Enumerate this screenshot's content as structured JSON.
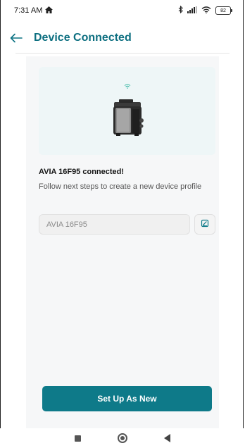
{
  "status_bar": {
    "time": "7:31 AM",
    "home_icon": "home-icon",
    "bluetooth_icon": "bluetooth-icon",
    "signal_icon": "signal-icon",
    "wifi_icon": "wifi-icon",
    "battery_level": "82"
  },
  "header": {
    "back_icon": "back-arrow-icon",
    "title": "Device Connected"
  },
  "device": {
    "wifi_indicator": "wifi-icon",
    "image": "device-icon",
    "connected_message": "AVIA 16F95 connected!",
    "instructions": "Follow next steps to create a new device profile"
  },
  "profile_form": {
    "name_value": "AVIA 16F95",
    "edit_icon": "edit-icon"
  },
  "actions": {
    "setup_label": "Set Up As New"
  },
  "nav_bar": {
    "recents_icon": "square-icon",
    "home_icon": "circle-icon",
    "back_icon": "triangle-back-icon"
  },
  "colors": {
    "accent": "#0e7a89",
    "title": "#0d6f80",
    "card_bg": "#eef6f7",
    "panel_bg": "#f6f7f8"
  }
}
